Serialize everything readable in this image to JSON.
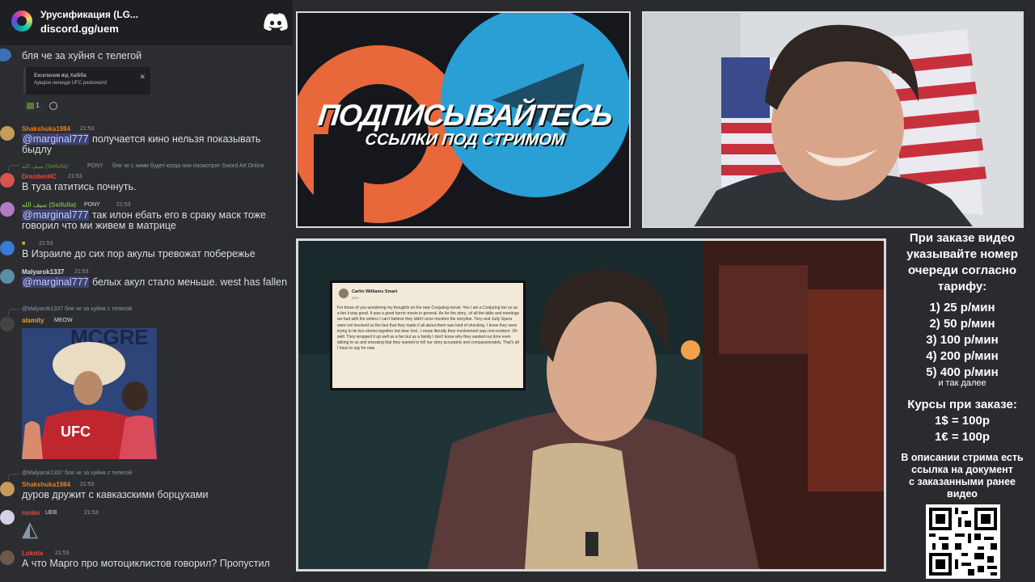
{
  "discord": {
    "server_name": "Урусификация (LG...",
    "invite": "discord.gg/uem"
  },
  "chat": {
    "messages": [
      {
        "text": "бля че за хуйня с телегой"
      },
      {
        "embed_title": "Ексклюзив від Хабіба",
        "embed_sub": "Аукціон легенди UFC розпочато!",
        "reaction_count": "1"
      },
      {
        "user": "Shakshuka1984",
        "time": "21:53",
        "mention": "@marginal777",
        "text": "получается кино нельзя показывать быдлу"
      },
      {
        "reply": "бля че с ними будет когда они посмотрят Sword Art Online",
        "reply_badge": "PONY",
        "user": "DrezdenHC",
        "time": "21:53",
        "text": "В туза гатитись почнуть."
      },
      {
        "user": "سيف الله (Seifulla)",
        "badge": "PONY",
        "time": "21:53",
        "mention": "@marginal777",
        "text": "так илон ебать его в сраку маск тоже говорил что ми живем в матрице"
      },
      {
        "time": "21:53",
        "text": "В Израиле до сих пор акулы тревожат побережье"
      },
      {
        "user": "Malyarok1337",
        "time": "21:53",
        "mention": "@marginal777",
        "text": "белых акул стало меньше. west has fallen"
      },
      {
        "reply": "@Malyarok1337 бля че за хуйня с телегой",
        "user": "alamity",
        "badge": "MEOW",
        "gif_label": "UFC"
      },
      {
        "reply": "@Malyarok1337 бля че за хуйня с телегой",
        "user": "Shakshuka1984",
        "time": "21:53",
        "text": "дуров дружит с кавказскими борцухами"
      },
      {
        "user": "runko",
        "badge": "UEB",
        "time": "21:53"
      },
      {
        "user": "Lokota",
        "time": "21:53",
        "text": "А что Марго про мотоциклистов говорил? Пропустил"
      }
    ]
  },
  "promo": {
    "headline": "ПОДПИСЫВАЙТЕСЬ",
    "sub": "ССЫЛКИ ПОД СТРИМОМ",
    "colors": {
      "patreon": "#e8683c",
      "telegram": "#2a9fd6"
    }
  },
  "video": {
    "post_author": "Carlin Williams Smart",
    "post_time": "21m",
    "post_body": "For those of you wondering my thoughts on the new Conjuring movie: Yes I am a Conjuring fan so as a fan it was good. It was a good horror movie in general. As for the story...of all the talks and meetings we had with the writers I can't believe they didn't once mention the storyline. Tony and Judy Spera were not involved so the fact that they made it all about them was kind of shocking. I know they were trying to tie two stories together but dear lord...I mean literally their involvement was non-existent. Oh well. They wrapped it up well as a fan but as a family I don't know why they wasted our time even talking to us and stressing that they wanted to tell our story accurately and compassionately. That's all I have to say for now."
  },
  "info": {
    "intro": [
      "При заказе видео",
      "указывайте номер",
      "очереди согласно",
      "тарифу:"
    ],
    "tariffs": [
      "1) 25 р/мин",
      "2) 50 р/мин",
      "3) 100 р/мин",
      "4) 200 р/мин",
      "5) 400 р/мин"
    ],
    "tariff_tail": "и так далее",
    "rates_title": "Курсы при заказе:",
    "rates": [
      "1$ = 100р",
      "1€ = 100р"
    ],
    "desc": [
      "В описании стрима есть",
      "ссылка на документ",
      "с заказанными ранее",
      "видео"
    ]
  }
}
